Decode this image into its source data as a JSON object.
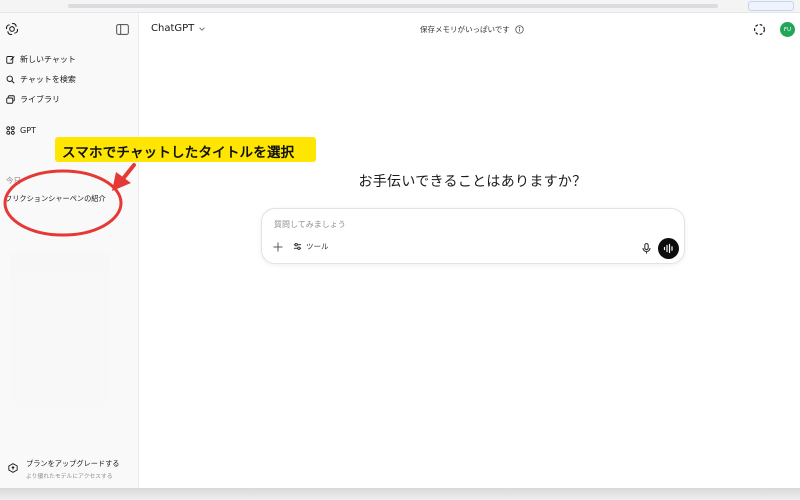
{
  "sidebar": {
    "items": [
      {
        "label": "新しいチャット",
        "icon": "edit-icon"
      },
      {
        "label": "チャットを検索",
        "icon": "search-icon"
      },
      {
        "label": "ライブラリ",
        "icon": "library-icon"
      },
      {
        "label": "GPT",
        "icon": "grid-icon"
      }
    ],
    "date_label": "今日",
    "chat_title": "フリクションシャーペンの紹介",
    "upgrade": {
      "title": "プランをアップグレードする",
      "subtitle": "より優れたモデルにアクセスする"
    }
  },
  "header": {
    "model": "ChatGPT",
    "memory_notice": "保存メモリがいっぱいです",
    "avatar_initials": "FU"
  },
  "main": {
    "greeting": "お手伝いできることはありますか？",
    "composer": {
      "placeholder": "質問してみましょう",
      "tools_label": "ツール"
    }
  },
  "annotation": {
    "callout_text": "スマホでチャットしたタイトルを選択",
    "callout_color": "#ffe600",
    "highlight_color": "#e53935"
  },
  "colors": {
    "avatar": "#23a55a",
    "sidebar_bg": "#f9f9f9"
  }
}
